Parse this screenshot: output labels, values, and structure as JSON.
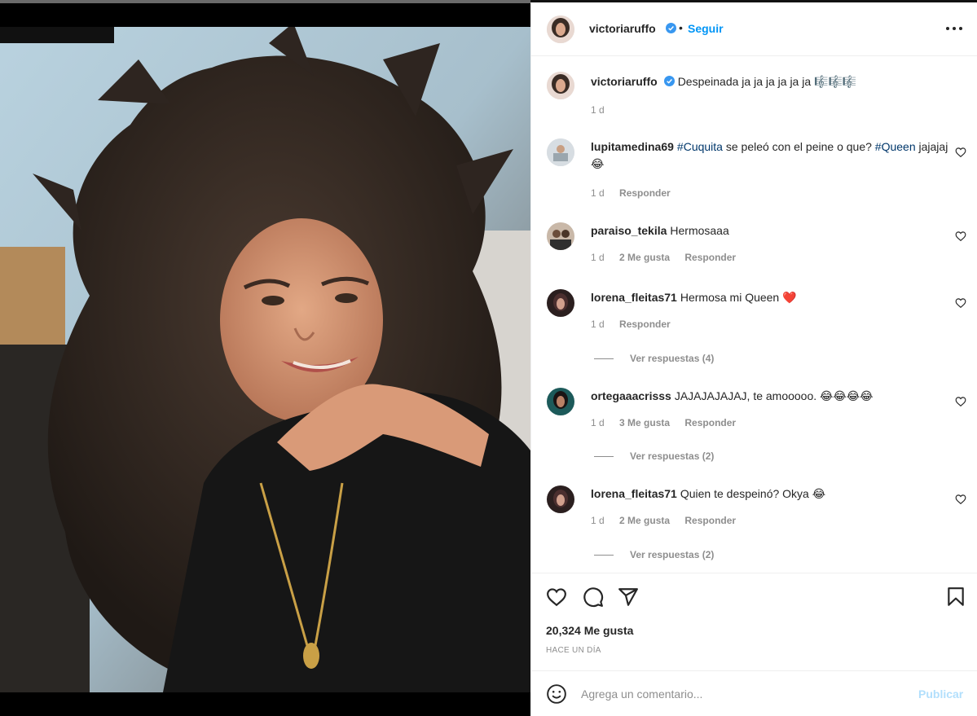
{
  "post": {
    "author": "victoriaruffo",
    "follow_label": "Seguir",
    "separator": "•",
    "caption_text": "Despeinada ja ja ja ja ja ja",
    "caption_emoji": "🎼🎼🎼",
    "caption_time": "1 d",
    "likes": "20,324 Me gusta",
    "time_ago": "HACE UN DÍA"
  },
  "comments": [
    {
      "user": "lupitamedina69",
      "parts": [
        "#Cuquita",
        " se peleó con el peine o que? ",
        "#Queen",
        " jajajaj 😂"
      ],
      "time": "1 d",
      "likes": "",
      "reply": "Responder",
      "view_replies": ""
    },
    {
      "user": "paraiso_tekila",
      "text": "Hermosaaa",
      "time": "1 d",
      "likes": "2 Me gusta",
      "reply": "Responder",
      "view_replies": ""
    },
    {
      "user": "lorena_fleitas71",
      "text": "Hermosa mi Queen ❤️",
      "time": "1 d",
      "likes": "",
      "reply": "Responder",
      "view_replies": "Ver respuestas (4)"
    },
    {
      "user": "ortegaaacrisss",
      "text": "JAJAJAJAJAJ, te amooooo. 😂😂😂😂",
      "time": "1 d",
      "likes": "3 Me gusta",
      "reply": "Responder",
      "view_replies": "Ver respuestas (2)"
    },
    {
      "user": "lorena_fleitas71",
      "text": "Quien te despeinó? Okya 😂",
      "time": "1 d",
      "likes": "2 Me gusta",
      "reply": "Responder",
      "view_replies": "Ver respuestas (2)"
    }
  ],
  "composer": {
    "placeholder": "Agrega un comentario...",
    "publish_label": "Publicar"
  },
  "icons": {
    "verified": "verified-badge-icon",
    "more": "more-options-icon",
    "like": "heart-icon",
    "comment": "comment-bubble-icon",
    "share": "paper-plane-icon",
    "save": "bookmark-icon",
    "emoji": "emoji-smile-icon"
  },
  "colors": {
    "link_blue": "#0095f6",
    "hashtag": "#00376b",
    "muted": "#8e8e8e",
    "verified": "#3897f0",
    "publish_disabled": "#b2dffc"
  }
}
